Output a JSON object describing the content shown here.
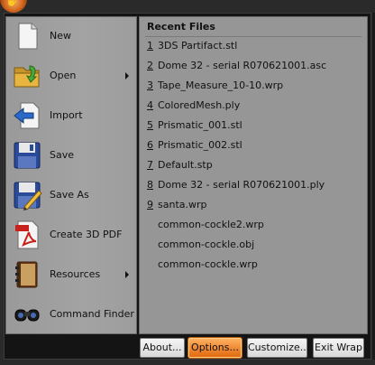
{
  "commands": [
    {
      "label": "New",
      "icon": "new-document-icon",
      "submenu": false
    },
    {
      "label": "Open",
      "icon": "open-folder-icon",
      "submenu": true
    },
    {
      "label": "Import",
      "icon": "import-arrow-icon",
      "submenu": false
    },
    {
      "label": "Save",
      "icon": "floppy-disk-icon",
      "submenu": false
    },
    {
      "label": "Save As",
      "icon": "save-as-icon",
      "submenu": false
    },
    {
      "label": "Create 3D PDF",
      "icon": "pdf-document-icon",
      "submenu": false
    },
    {
      "label": "Resources",
      "icon": "book-icon",
      "submenu": true
    },
    {
      "label": "Command Finder",
      "icon": "binoculars-icon",
      "submenu": false
    }
  ],
  "recent": {
    "title": "Recent Files",
    "items": [
      {
        "num": "1",
        "name": "3DS Partifact.stl"
      },
      {
        "num": "2",
        "name": "Dome 32 - serial R070621001.asc"
      },
      {
        "num": "3",
        "name": "Tape_Measure_10-10.wrp"
      },
      {
        "num": "4",
        "name": "ColoredMesh.ply"
      },
      {
        "num": "5",
        "name": "Prismatic_001.stl"
      },
      {
        "num": "6",
        "name": "Prismatic_002.stl"
      },
      {
        "num": "7",
        "name": "Default.stp"
      },
      {
        "num": "8",
        "name": "Dome 32 - serial R070621001.ply"
      },
      {
        "num": "9",
        "name": "santa.wrp"
      },
      {
        "num": "",
        "name": "common-cockle2.wrp"
      },
      {
        "num": "",
        "name": "common-cockle.obj"
      },
      {
        "num": "",
        "name": "common-cockle.wrp"
      }
    ]
  },
  "buttons": {
    "about": "About...",
    "options": "Options...",
    "customize": "Customize...",
    "exit": "Exit Wrap"
  },
  "colors": {
    "accent": "#e87a1c",
    "pane": "#969696"
  }
}
